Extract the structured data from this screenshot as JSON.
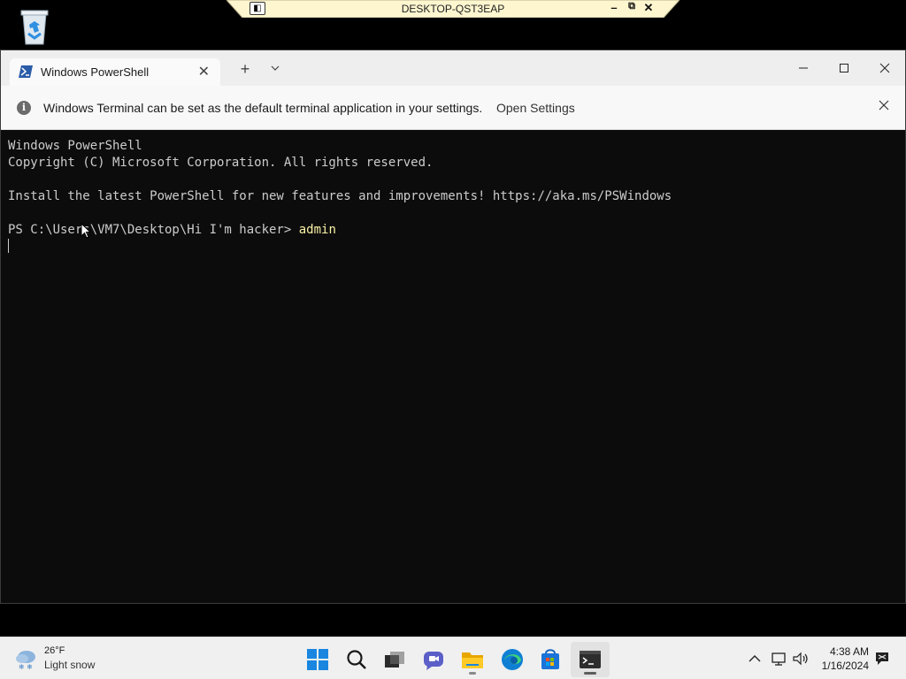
{
  "remote_bar": {
    "title": "DESKTOP-QST3EAP"
  },
  "terminal": {
    "tab_title": "Windows PowerShell",
    "infobar": {
      "message": "Windows Terminal can be set as the default terminal application in your settings.",
      "action": "Open Settings"
    },
    "console": {
      "line1": "Windows PowerShell",
      "line2": "Copyright (C) Microsoft Corporation. All rights reserved.",
      "line3": "Install the latest PowerShell for new features and improvements! https://aka.ms/PSWindows",
      "prompt": "PS C:\\Users\\VM7\\Desktop\\Hi I'm hacker> ",
      "command": "admin"
    }
  },
  "taskbar": {
    "weather": {
      "temperature": "26°F",
      "condition": "Light snow"
    },
    "clock": {
      "time": "4:38 AM",
      "date": "1/16/2024"
    },
    "apps": [
      "start-icon",
      "search-icon",
      "task-view-icon",
      "chat-icon",
      "file-explorer-icon",
      "edge-icon",
      "store-icon",
      "terminal-icon"
    ]
  },
  "colors": {
    "console_bg": "#0c0c0c",
    "console_text": "#cccccc",
    "command_text": "#f9f1a5",
    "accent": "#0078d4"
  }
}
